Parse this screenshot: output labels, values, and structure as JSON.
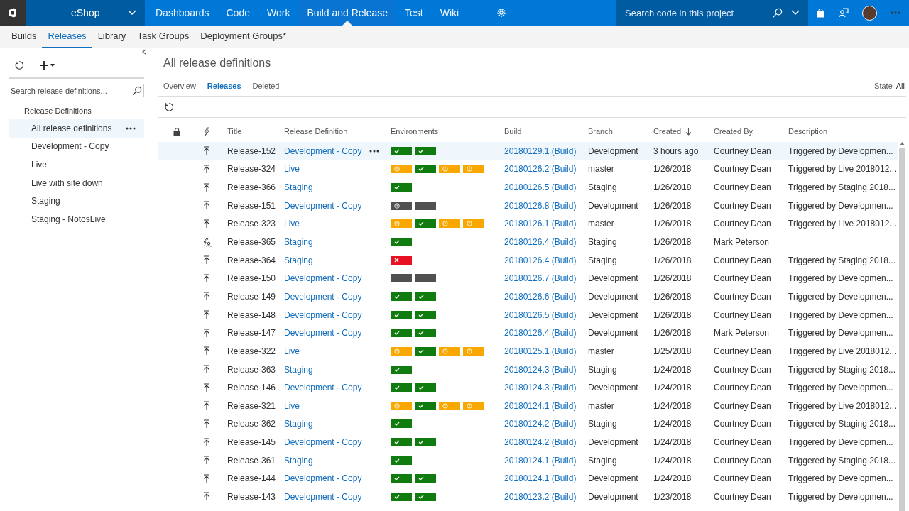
{
  "top_bar": {
    "project": "eShop",
    "nav": [
      {
        "label": "Dashboards",
        "selected": false
      },
      {
        "label": "Code",
        "selected": false
      },
      {
        "label": "Work",
        "selected": false
      },
      {
        "label": "Build and Release",
        "selected": true
      },
      {
        "label": "Test",
        "selected": false
      },
      {
        "label": "Wiki",
        "selected": false
      }
    ],
    "search": {
      "placeholder": "Search code in this project"
    }
  },
  "sub_nav": [
    {
      "label": "Builds",
      "selected": false
    },
    {
      "label": "Releases",
      "selected": true
    },
    {
      "label": "Library",
      "selected": false
    },
    {
      "label": "Task Groups",
      "selected": false
    },
    {
      "label": "Deployment Groups*",
      "selected": false
    }
  ],
  "sidebar": {
    "search": {
      "placeholder": "Search release definitions..."
    },
    "heading": "Release Definitions",
    "items": [
      {
        "label": "All release definitions",
        "selected": true
      },
      {
        "label": "Development - Copy",
        "selected": false
      },
      {
        "label": "Live",
        "selected": false
      },
      {
        "label": "Live with site down",
        "selected": false
      },
      {
        "label": "Staging",
        "selected": false
      },
      {
        "label": "Staging - NotosLive",
        "selected": false
      }
    ]
  },
  "page": {
    "title": "All release definitions",
    "tabs": [
      {
        "label": "Overview",
        "selected": false
      },
      {
        "label": "Releases",
        "selected": true
      },
      {
        "label": "Deleted",
        "selected": false
      }
    ],
    "state_filter": {
      "label": "State",
      "value": "All"
    }
  },
  "table": {
    "columns": [
      "Title",
      "Release Definition",
      "Environments",
      "Build",
      "Branch",
      "Created",
      "Created By",
      "Description"
    ],
    "rows": [
      {
        "kind": "ci",
        "title": "Release-152",
        "definition": "Development - Copy",
        "environments": [
          {
            "kind": "succeeded"
          },
          {
            "kind": "succeeded"
          }
        ],
        "build": "20180129.1 (Build)",
        "branch": "Development",
        "created": "3 hours ago",
        "created_by": "Courtney Dean",
        "description": "Triggered by Developmen...",
        "selected": true
      },
      {
        "kind": "ci",
        "title": "Release-324",
        "definition": "Live",
        "environments": [
          {
            "kind": "partial"
          },
          {
            "kind": "succeeded"
          },
          {
            "kind": "partial"
          },
          {
            "kind": "partial"
          }
        ],
        "build": "20180126.2 (Build)",
        "branch": "master",
        "created": "1/26/2018",
        "created_by": "Courtney Dean",
        "description": "Triggered by Live 2018012...",
        "selected": false
      },
      {
        "kind": "ci",
        "title": "Release-366",
        "definition": "Staging",
        "environments": [
          {
            "kind": "succeeded"
          }
        ],
        "build": "20180126.5 (Build)",
        "branch": "Staging",
        "created": "1/26/2018",
        "created_by": "Courtney Dean",
        "description": "Triggered by Staging 2018...",
        "selected": false
      },
      {
        "kind": "ci",
        "title": "Release-151",
        "definition": "Development - Copy",
        "environments": [
          {
            "kind": "pending"
          },
          {
            "kind": "notdeployed"
          }
        ],
        "build": "20180126.8 (Build)",
        "branch": "Development",
        "created": "1/26/2018",
        "created_by": "Courtney Dean",
        "description": "Triggered by Developmen...",
        "selected": false
      },
      {
        "kind": "ci",
        "title": "Release-323",
        "definition": "Live",
        "environments": [
          {
            "kind": "partial"
          },
          {
            "kind": "succeeded"
          },
          {
            "kind": "partial"
          },
          {
            "kind": "partial"
          }
        ],
        "build": "20180126.1 (Build)",
        "branch": "master",
        "created": "1/26/2018",
        "created_by": "Courtney Dean",
        "description": "Triggered by Live 2018012...",
        "selected": false
      },
      {
        "kind": "manual",
        "title": "Release-365",
        "definition": "Staging",
        "environments": [
          {
            "kind": "succeeded"
          }
        ],
        "build": "20180126.4 (Build)",
        "branch": "Staging",
        "created": "1/26/2018",
        "created_by": "Mark Peterson",
        "selected": false
      },
      {
        "kind": "ci",
        "title": "Release-364",
        "definition": "Staging",
        "environments": [
          {
            "kind": "failed"
          }
        ],
        "build": "20180126.4 (Build)",
        "branch": "Staging",
        "created": "1/26/2018",
        "created_by": "Courtney Dean",
        "description": "Triggered by Staging 2018...",
        "selected": false
      },
      {
        "kind": "ci",
        "title": "Release-150",
        "definition": "Development - Copy",
        "environments": [
          {
            "kind": "notdeployed"
          },
          {
            "kind": "notdeployed"
          }
        ],
        "build": "20180126.7 (Build)",
        "branch": "Development",
        "created": "1/26/2018",
        "created_by": "Courtney Dean",
        "description": "Triggered by Developmen...",
        "selected": false
      },
      {
        "kind": "ci",
        "title": "Release-149",
        "definition": "Development - Copy",
        "environments": [
          {
            "kind": "succeeded"
          },
          {
            "kind": "succeeded"
          }
        ],
        "build": "20180126.6 (Build)",
        "branch": "Development",
        "created": "1/26/2018",
        "created_by": "Courtney Dean",
        "description": "Triggered by Developmen...",
        "selected": false
      },
      {
        "kind": "ci",
        "title": "Release-148",
        "definition": "Development - Copy",
        "environments": [
          {
            "kind": "succeeded"
          },
          {
            "kind": "succeeded"
          }
        ],
        "build": "20180126.5 (Build)",
        "branch": "Development",
        "created": "1/26/2018",
        "created_by": "Courtney Dean",
        "description": "Triggered by Developmen...",
        "selected": false
      },
      {
        "kind": "ci",
        "title": "Release-147",
        "definition": "Development - Copy",
        "environments": [
          {
            "kind": "succeeded"
          },
          {
            "kind": "succeeded"
          }
        ],
        "build": "20180126.4 (Build)",
        "branch": "Development",
        "created": "1/26/2018",
        "created_by": "Mark Peterson",
        "description": "Triggered by Developmen...",
        "selected": false
      },
      {
        "kind": "ci",
        "title": "Release-322",
        "definition": "Live",
        "environments": [
          {
            "kind": "partial"
          },
          {
            "kind": "succeeded"
          },
          {
            "kind": "partial"
          },
          {
            "kind": "partial"
          }
        ],
        "build": "20180125.1 (Build)",
        "branch": "master",
        "created": "1/25/2018",
        "created_by": "Courtney Dean",
        "description": "Triggered by Live 2018012...",
        "selected": false
      },
      {
        "kind": "ci",
        "title": "Release-363",
        "definition": "Staging",
        "environments": [
          {
            "kind": "succeeded"
          }
        ],
        "build": "20180124.3 (Build)",
        "branch": "Staging",
        "created": "1/24/2018",
        "created_by": "Courtney Dean",
        "description": "Triggered by Staging 2018...",
        "selected": false
      },
      {
        "kind": "ci",
        "title": "Release-146",
        "definition": "Development - Copy",
        "environments": [
          {
            "kind": "succeeded"
          },
          {
            "kind": "succeeded"
          }
        ],
        "build": "20180124.3 (Build)",
        "branch": "Development",
        "created": "1/24/2018",
        "created_by": "Courtney Dean",
        "description": "Triggered by Developmen...",
        "selected": false
      },
      {
        "kind": "ci",
        "title": "Release-321",
        "definition": "Live",
        "environments": [
          {
            "kind": "partial"
          },
          {
            "kind": "succeeded"
          },
          {
            "kind": "partial"
          },
          {
            "kind": "partial"
          }
        ],
        "build": "20180124.1 (Build)",
        "branch": "master",
        "created": "1/24/2018",
        "created_by": "Courtney Dean",
        "description": "Triggered by Live 2018012...",
        "selected": false
      },
      {
        "kind": "ci",
        "title": "Release-362",
        "definition": "Staging",
        "environments": [
          {
            "kind": "succeeded"
          }
        ],
        "build": "20180124.2 (Build)",
        "branch": "Staging",
        "created": "1/24/2018",
        "created_by": "Courtney Dean",
        "description": "Triggered by Staging 2018...",
        "selected": false
      },
      {
        "kind": "ci",
        "title": "Release-145",
        "definition": "Development - Copy",
        "environments": [
          {
            "kind": "succeeded"
          },
          {
            "kind": "succeeded"
          }
        ],
        "build": "20180124.2 (Build)",
        "branch": "Development",
        "created": "1/24/2018",
        "created_by": "Courtney Dean",
        "description": "Triggered by Developmen...",
        "selected": false
      },
      {
        "kind": "ci",
        "title": "Release-361",
        "definition": "Staging",
        "environments": [
          {
            "kind": "succeeded"
          }
        ],
        "build": "20180124.1 (Build)",
        "branch": "Staging",
        "created": "1/24/2018",
        "created_by": "Courtney Dean",
        "description": "Triggered by Staging 2018...",
        "selected": false
      },
      {
        "kind": "ci",
        "title": "Release-144",
        "definition": "Development - Copy",
        "environments": [
          {
            "kind": "succeeded"
          },
          {
            "kind": "succeeded"
          }
        ],
        "build": "20180124.1 (Build)",
        "branch": "Development",
        "created": "1/24/2018",
        "created_by": "Courtney Dean",
        "description": "Triggered by Developmen...",
        "selected": false
      },
      {
        "kind": "ci",
        "title": "Release-143",
        "definition": "Development - Copy",
        "environments": [
          {
            "kind": "succeeded"
          },
          {
            "kind": "succeeded"
          }
        ],
        "build": "20180123.2 (Build)",
        "branch": "Development",
        "created": "1/23/2018",
        "created_by": "Courtney Dean",
        "description": "Triggered by Developmen...",
        "selected": false
      }
    ]
  }
}
